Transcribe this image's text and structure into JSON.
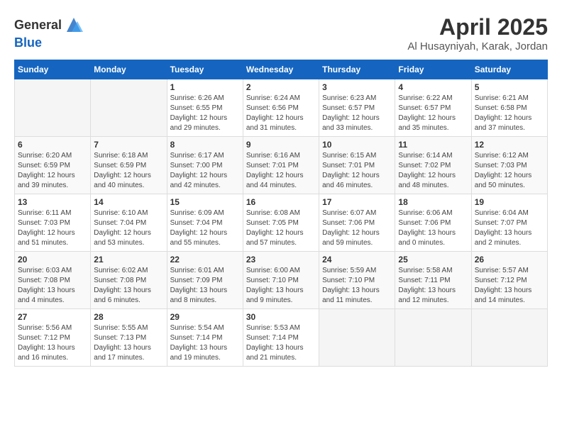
{
  "header": {
    "logo_general": "General",
    "logo_blue": "Blue",
    "title": "April 2025",
    "location": "Al Husayniyah, Karak, Jordan"
  },
  "calendar": {
    "days_of_week": [
      "Sunday",
      "Monday",
      "Tuesday",
      "Wednesday",
      "Thursday",
      "Friday",
      "Saturday"
    ],
    "weeks": [
      [
        {
          "day": "",
          "info": ""
        },
        {
          "day": "",
          "info": ""
        },
        {
          "day": "1",
          "info": "Sunrise: 6:26 AM\nSunset: 6:55 PM\nDaylight: 12 hours\nand 29 minutes."
        },
        {
          "day": "2",
          "info": "Sunrise: 6:24 AM\nSunset: 6:56 PM\nDaylight: 12 hours\nand 31 minutes."
        },
        {
          "day": "3",
          "info": "Sunrise: 6:23 AM\nSunset: 6:57 PM\nDaylight: 12 hours\nand 33 minutes."
        },
        {
          "day": "4",
          "info": "Sunrise: 6:22 AM\nSunset: 6:57 PM\nDaylight: 12 hours\nand 35 minutes."
        },
        {
          "day": "5",
          "info": "Sunrise: 6:21 AM\nSunset: 6:58 PM\nDaylight: 12 hours\nand 37 minutes."
        }
      ],
      [
        {
          "day": "6",
          "info": "Sunrise: 6:20 AM\nSunset: 6:59 PM\nDaylight: 12 hours\nand 39 minutes."
        },
        {
          "day": "7",
          "info": "Sunrise: 6:18 AM\nSunset: 6:59 PM\nDaylight: 12 hours\nand 40 minutes."
        },
        {
          "day": "8",
          "info": "Sunrise: 6:17 AM\nSunset: 7:00 PM\nDaylight: 12 hours\nand 42 minutes."
        },
        {
          "day": "9",
          "info": "Sunrise: 6:16 AM\nSunset: 7:01 PM\nDaylight: 12 hours\nand 44 minutes."
        },
        {
          "day": "10",
          "info": "Sunrise: 6:15 AM\nSunset: 7:01 PM\nDaylight: 12 hours\nand 46 minutes."
        },
        {
          "day": "11",
          "info": "Sunrise: 6:14 AM\nSunset: 7:02 PM\nDaylight: 12 hours\nand 48 minutes."
        },
        {
          "day": "12",
          "info": "Sunrise: 6:12 AM\nSunset: 7:03 PM\nDaylight: 12 hours\nand 50 minutes."
        }
      ],
      [
        {
          "day": "13",
          "info": "Sunrise: 6:11 AM\nSunset: 7:03 PM\nDaylight: 12 hours\nand 51 minutes."
        },
        {
          "day": "14",
          "info": "Sunrise: 6:10 AM\nSunset: 7:04 PM\nDaylight: 12 hours\nand 53 minutes."
        },
        {
          "day": "15",
          "info": "Sunrise: 6:09 AM\nSunset: 7:04 PM\nDaylight: 12 hours\nand 55 minutes."
        },
        {
          "day": "16",
          "info": "Sunrise: 6:08 AM\nSunset: 7:05 PM\nDaylight: 12 hours\nand 57 minutes."
        },
        {
          "day": "17",
          "info": "Sunrise: 6:07 AM\nSunset: 7:06 PM\nDaylight: 12 hours\nand 59 minutes."
        },
        {
          "day": "18",
          "info": "Sunrise: 6:06 AM\nSunset: 7:06 PM\nDaylight: 13 hours\nand 0 minutes."
        },
        {
          "day": "19",
          "info": "Sunrise: 6:04 AM\nSunset: 7:07 PM\nDaylight: 13 hours\nand 2 minutes."
        }
      ],
      [
        {
          "day": "20",
          "info": "Sunrise: 6:03 AM\nSunset: 7:08 PM\nDaylight: 13 hours\nand 4 minutes."
        },
        {
          "day": "21",
          "info": "Sunrise: 6:02 AM\nSunset: 7:08 PM\nDaylight: 13 hours\nand 6 minutes."
        },
        {
          "day": "22",
          "info": "Sunrise: 6:01 AM\nSunset: 7:09 PM\nDaylight: 13 hours\nand 8 minutes."
        },
        {
          "day": "23",
          "info": "Sunrise: 6:00 AM\nSunset: 7:10 PM\nDaylight: 13 hours\nand 9 minutes."
        },
        {
          "day": "24",
          "info": "Sunrise: 5:59 AM\nSunset: 7:10 PM\nDaylight: 13 hours\nand 11 minutes."
        },
        {
          "day": "25",
          "info": "Sunrise: 5:58 AM\nSunset: 7:11 PM\nDaylight: 13 hours\nand 12 minutes."
        },
        {
          "day": "26",
          "info": "Sunrise: 5:57 AM\nSunset: 7:12 PM\nDaylight: 13 hours\nand 14 minutes."
        }
      ],
      [
        {
          "day": "27",
          "info": "Sunrise: 5:56 AM\nSunset: 7:12 PM\nDaylight: 13 hours\nand 16 minutes."
        },
        {
          "day": "28",
          "info": "Sunrise: 5:55 AM\nSunset: 7:13 PM\nDaylight: 13 hours\nand 17 minutes."
        },
        {
          "day": "29",
          "info": "Sunrise: 5:54 AM\nSunset: 7:14 PM\nDaylight: 13 hours\nand 19 minutes."
        },
        {
          "day": "30",
          "info": "Sunrise: 5:53 AM\nSunset: 7:14 PM\nDaylight: 13 hours\nand 21 minutes."
        },
        {
          "day": "",
          "info": ""
        },
        {
          "day": "",
          "info": ""
        },
        {
          "day": "",
          "info": ""
        }
      ]
    ]
  }
}
